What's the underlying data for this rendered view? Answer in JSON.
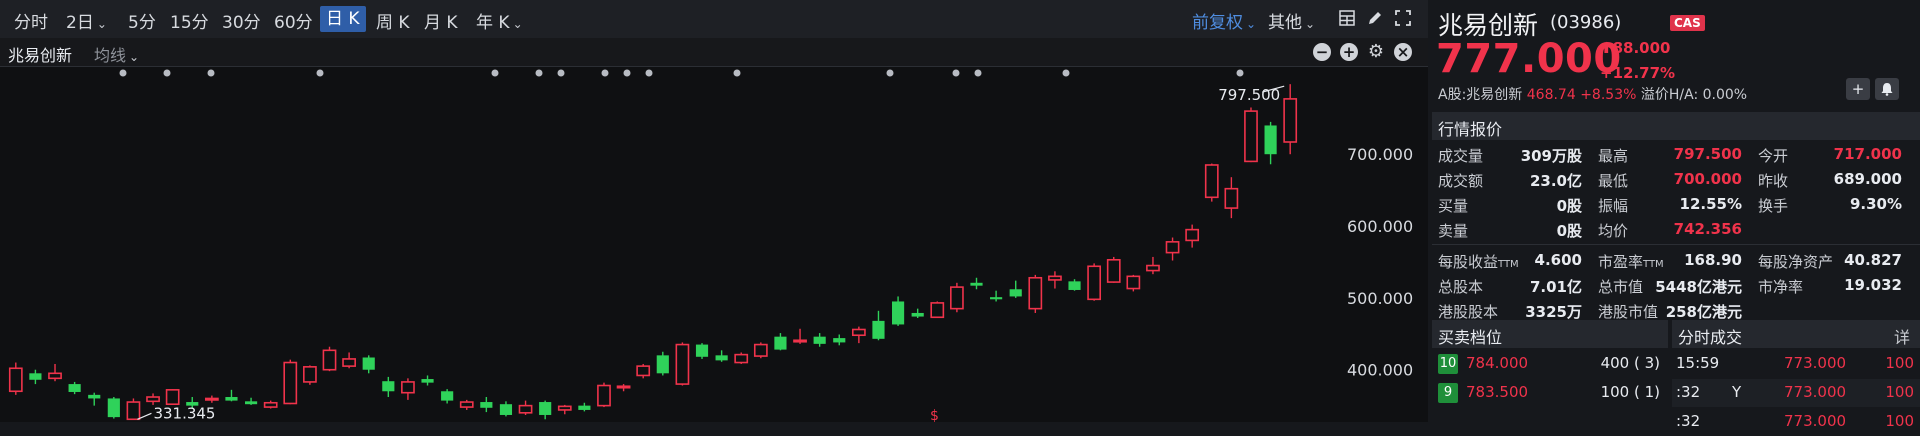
{
  "toolbar": {
    "intervals": [
      "分时",
      "2日",
      "5分",
      "15分",
      "30分",
      "60分",
      "日 K",
      "周 K",
      "月 K",
      "年 K"
    ],
    "active_interval": "日 K",
    "adjust_label": "前复权",
    "other_label": "其他"
  },
  "subbar": {
    "stock_title": "兆易创新",
    "ma_label": "均线"
  },
  "chart_data": {
    "type": "candlestick",
    "y_ticks": [
      "700.000",
      "600.000",
      "500.000",
      "400.000"
    ],
    "ylim": [
      330,
      820
    ],
    "high_annotation": "797.500",
    "low_annotation": "331.345",
    "marker_label": "$",
    "up_color": "#f0334b",
    "down_color": "#2fd25a",
    "candles": [
      {
        "o": 370,
        "h": 410,
        "l": 365,
        "c": 402
      },
      {
        "o": 395,
        "h": 400,
        "l": 380,
        "c": 386
      },
      {
        "o": 388,
        "h": 408,
        "l": 384,
        "c": 395
      },
      {
        "o": 380,
        "h": 383,
        "l": 366,
        "c": 369
      },
      {
        "o": 365,
        "h": 368,
        "l": 350,
        "c": 360
      },
      {
        "o": 360,
        "h": 362,
        "l": 332,
        "c": 334
      },
      {
        "o": 331,
        "h": 360,
        "l": 331,
        "c": 355
      },
      {
        "o": 356,
        "h": 367,
        "l": 351,
        "c": 362
      },
      {
        "o": 352,
        "h": 373,
        "l": 351,
        "c": 372
      },
      {
        "o": 355,
        "h": 362,
        "l": 346,
        "c": 350
      },
      {
        "o": 358,
        "h": 364,
        "l": 354,
        "c": 360
      },
      {
        "o": 362,
        "h": 372,
        "l": 356,
        "c": 357
      },
      {
        "o": 356,
        "h": 361,
        "l": 351,
        "c": 352
      },
      {
        "o": 348,
        "h": 357,
        "l": 346,
        "c": 354
      },
      {
        "o": 353,
        "h": 414,
        "l": 352,
        "c": 410
      },
      {
        "o": 383,
        "h": 406,
        "l": 379,
        "c": 404
      },
      {
        "o": 400,
        "h": 432,
        "l": 398,
        "c": 427
      },
      {
        "o": 405,
        "h": 424,
        "l": 402,
        "c": 415
      },
      {
        "o": 417,
        "h": 420,
        "l": 395,
        "c": 400
      },
      {
        "o": 384,
        "h": 390,
        "l": 362,
        "c": 370
      },
      {
        "o": 368,
        "h": 388,
        "l": 358,
        "c": 383
      },
      {
        "o": 387,
        "h": 392,
        "l": 378,
        "c": 382
      },
      {
        "o": 370,
        "h": 373,
        "l": 353,
        "c": 357
      },
      {
        "o": 348,
        "h": 358,
        "l": 344,
        "c": 355
      },
      {
        "o": 355,
        "h": 362,
        "l": 341,
        "c": 347
      },
      {
        "o": 352,
        "h": 356,
        "l": 335,
        "c": 337
      },
      {
        "o": 340,
        "h": 357,
        "l": 337,
        "c": 350
      },
      {
        "o": 355,
        "h": 357,
        "l": 331,
        "c": 337
      },
      {
        "o": 344,
        "h": 351,
        "l": 338,
        "c": 349
      },
      {
        "o": 350,
        "h": 354,
        "l": 342,
        "c": 344
      },
      {
        "o": 350,
        "h": 382,
        "l": 348,
        "c": 378
      },
      {
        "o": 375,
        "h": 380,
        "l": 370,
        "c": 377
      },
      {
        "o": 392,
        "h": 408,
        "l": 388,
        "c": 405
      },
      {
        "o": 420,
        "h": 425,
        "l": 392,
        "c": 395
      },
      {
        "o": 380,
        "h": 438,
        "l": 378,
        "c": 435
      },
      {
        "o": 435,
        "h": 437,
        "l": 415,
        "c": 418
      },
      {
        "o": 420,
        "h": 427,
        "l": 411,
        "c": 413
      },
      {
        "o": 410,
        "h": 424,
        "l": 408,
        "c": 421
      },
      {
        "o": 419,
        "h": 438,
        "l": 416,
        "c": 435
      },
      {
        "o": 446,
        "h": 451,
        "l": 427,
        "c": 428
      },
      {
        "o": 440,
        "h": 457,
        "l": 436,
        "c": 441
      },
      {
        "o": 446,
        "h": 451,
        "l": 432,
        "c": 436
      },
      {
        "o": 444,
        "h": 449,
        "l": 434,
        "c": 438
      },
      {
        "o": 448,
        "h": 460,
        "l": 437,
        "c": 456
      },
      {
        "o": 468,
        "h": 482,
        "l": 441,
        "c": 443
      },
      {
        "o": 495,
        "h": 502,
        "l": 461,
        "c": 463
      },
      {
        "o": 479,
        "h": 485,
        "l": 472,
        "c": 474
      },
      {
        "o": 473,
        "h": 495,
        "l": 472,
        "c": 493
      },
      {
        "o": 485,
        "h": 521,
        "l": 480,
        "c": 515
      },
      {
        "o": 521,
        "h": 528,
        "l": 512,
        "c": 517
      },
      {
        "o": 501,
        "h": 510,
        "l": 495,
        "c": 498
      },
      {
        "o": 512,
        "h": 524,
        "l": 500,
        "c": 502
      },
      {
        "o": 485,
        "h": 532,
        "l": 479,
        "c": 528
      },
      {
        "o": 525,
        "h": 537,
        "l": 513,
        "c": 530
      },
      {
        "o": 523,
        "h": 526,
        "l": 510,
        "c": 511
      },
      {
        "o": 498,
        "h": 548,
        "l": 496,
        "c": 544
      },
      {
        "o": 522,
        "h": 557,
        "l": 521,
        "c": 553
      },
      {
        "o": 513,
        "h": 532,
        "l": 509,
        "c": 530
      },
      {
        "o": 538,
        "h": 557,
        "l": 533,
        "c": 545
      },
      {
        "o": 563,
        "h": 584,
        "l": 552,
        "c": 578
      },
      {
        "o": 580,
        "h": 602,
        "l": 570,
        "c": 595
      },
      {
        "o": 640,
        "h": 687,
        "l": 634,
        "c": 685
      },
      {
        "o": 625,
        "h": 668,
        "l": 611,
        "c": 652
      },
      {
        "o": 690,
        "h": 765,
        "l": 689,
        "c": 760
      },
      {
        "o": 740,
        "h": 745,
        "l": 686,
        "c": 700
      },
      {
        "o": 717,
        "h": 797.5,
        "l": 700,
        "c": 777
      }
    ]
  },
  "quote": {
    "name": "兆易创新",
    "code": "(03986)",
    "badge": "CAS",
    "price": "777.000",
    "change": "88.000",
    "change_pct": "+12.77%",
    "a_share_label": "A股:兆易创新",
    "a_share_price": "468.74",
    "a_share_pct": "+8.53%",
    "premium_label": "溢价H/A:",
    "premium_value": "0.00%"
  },
  "market_section_title": "行情报价",
  "market_rows": [
    [
      {
        "label": "成交量",
        "value": "309万股",
        "red": false
      },
      {
        "label": "最高",
        "value": "797.500",
        "red": true
      },
      {
        "label": "今开",
        "value": "717.000",
        "red": true
      }
    ],
    [
      {
        "label": "成交额",
        "value": "23.0亿",
        "red": false
      },
      {
        "label": "最低",
        "value": "700.000",
        "red": true
      },
      {
        "label": "昨收",
        "value": "689.000",
        "red": false
      }
    ],
    [
      {
        "label": "买量",
        "value": "0股",
        "red": false
      },
      {
        "label": "振幅",
        "value": "12.55%",
        "red": false
      },
      {
        "label": "换手",
        "value": "9.30%",
        "red": false
      }
    ],
    [
      {
        "label": "卖量",
        "value": "0股",
        "red": false
      },
      {
        "label": "均价",
        "value": "742.356",
        "red": true
      },
      {
        "label": "",
        "value": "",
        "red": false
      }
    ]
  ],
  "fund_rows": [
    [
      {
        "label": "每股收益",
        "sub": "TTM",
        "value": "4.600"
      },
      {
        "label": "市盈率",
        "sub": "TTM",
        "value": "168.90"
      },
      {
        "label": "每股净资产",
        "sub": "",
        "value": "40.827"
      }
    ],
    [
      {
        "label": "总股本",
        "sub": "",
        "value": "7.01亿"
      },
      {
        "label": "总市值",
        "sub": "",
        "value": "5448亿港元"
      },
      {
        "label": "市净率",
        "sub": "",
        "value": "19.032"
      }
    ],
    [
      {
        "label": "港股股本",
        "sub": "",
        "value": "3325万"
      },
      {
        "label": "港股市值",
        "sub": "",
        "value": "258亿港元"
      },
      {
        "label": "",
        "sub": "",
        "value": ""
      }
    ]
  ],
  "orderbook": {
    "title": "买卖档位",
    "rows": [
      {
        "level": "10",
        "price": "784.000",
        "vol": "400 (",
        "count": "3)"
      },
      {
        "level": "9",
        "price": "783.500",
        "vol": "100 (",
        "count": "1)"
      }
    ]
  },
  "trades": {
    "title": "分时成交",
    "detail_label": "详",
    "rows": [
      {
        "time": "15:59",
        "flag": "",
        "price": "773.000",
        "vol": "100"
      },
      {
        "time": ":32",
        "flag": "Y",
        "price": "773.000",
        "vol": "100"
      },
      {
        "time": ":32",
        "flag": "",
        "price": "773.000",
        "vol": "100"
      }
    ]
  }
}
